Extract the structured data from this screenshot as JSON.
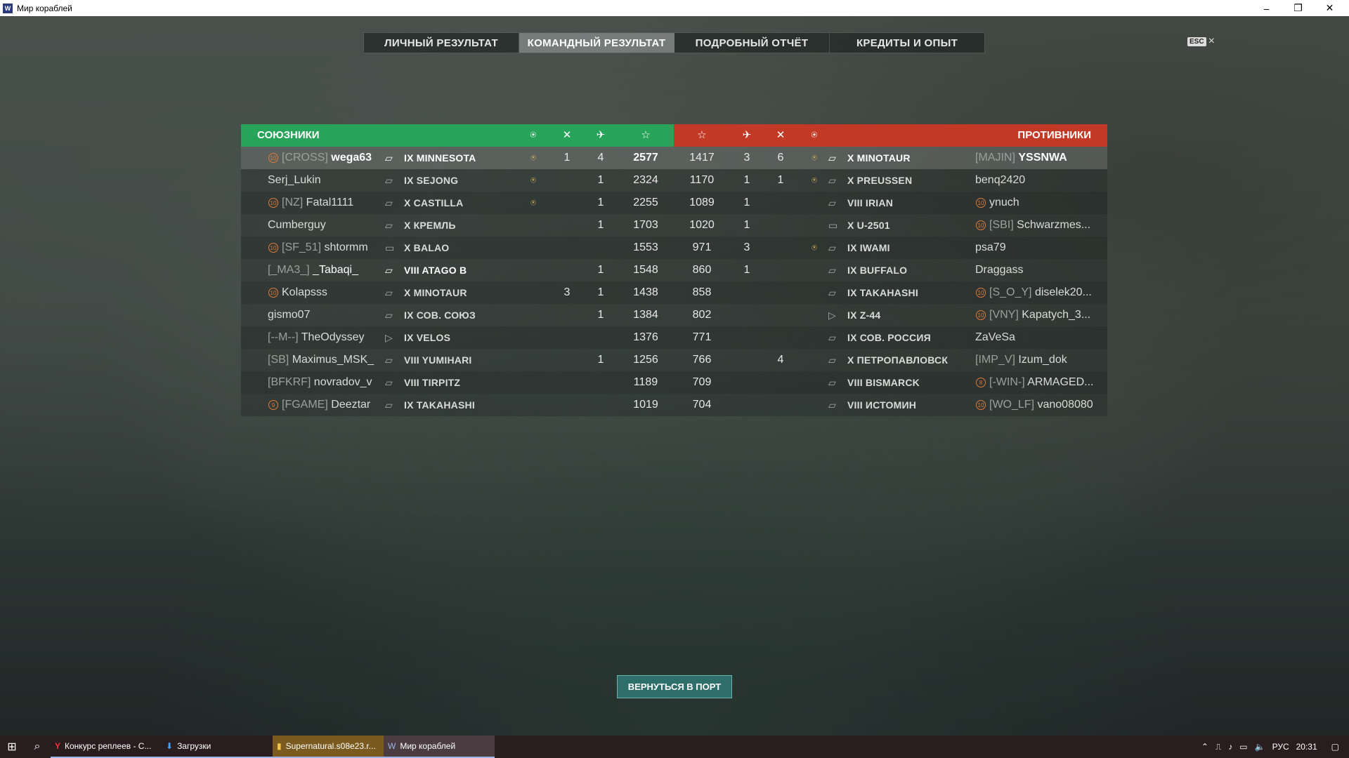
{
  "window": {
    "title": "Мир кораблей",
    "icon": "warships-app-icon"
  },
  "tabs": [
    {
      "label": "ЛИЧНЫЙ РЕЗУЛЬТАТ",
      "active": false
    },
    {
      "label": "КОМАНДНЫЙ РЕЗУЛЬТАТ",
      "active": true
    },
    {
      "label": "ПОДРОБНЫЙ ОТЧЁТ",
      "active": false
    },
    {
      "label": "КРЕДИТЫ И ОПЫТ",
      "active": false
    }
  ],
  "esc": {
    "key": "ESC",
    "close": "×"
  },
  "table": {
    "allies_label": "СОЮЗНИКИ",
    "enemies_label": "ПРОТИВНИКИ",
    "allies_color": "#27a35a",
    "enemies_color": "#c23a26",
    "allies": [
      {
        "rank": "10",
        "clan": "[CROSS]",
        "name": "wega63",
        "ship": "IX MINNESOTA",
        "medal": "yes",
        "kills": "1",
        "planes": "4",
        "xp": "2577",
        "highlight": true,
        "ship_icon": "battleship-icon"
      },
      {
        "rank": "",
        "clan": "",
        "name": "Serj_Lukin",
        "ship": "IX SEJONG",
        "medal": "yes",
        "kills": "",
        "planes": "1",
        "xp": "2324",
        "ship_icon": "battleship-icon"
      },
      {
        "rank": "10",
        "clan": "[NZ]",
        "name": "Fatal1111",
        "ship": "X CASTILLA",
        "medal": "yes",
        "kills": "",
        "planes": "1",
        "xp": "2255",
        "ship_icon": "battleship-icon"
      },
      {
        "rank": "",
        "clan": "",
        "name": "Cumberguy",
        "ship": "X КРЕМЛЬ",
        "medal": "",
        "kills": "",
        "planes": "1",
        "xp": "1703",
        "ship_icon": "battleship-icon"
      },
      {
        "rank": "10",
        "clan": "[SF_51]",
        "name": "shtormm",
        "ship": "X BALAO",
        "medal": "",
        "kills": "",
        "planes": "",
        "xp": "1553",
        "ship_icon": "submarine-icon"
      },
      {
        "rank": "",
        "clan": "[_MA3_]",
        "name": "_Tabaqi_",
        "ship": "VIII ATAGO B",
        "medal": "",
        "kills": "",
        "planes": "1",
        "xp": "1548",
        "highlight_name": true,
        "ship_icon": "cruiser-icon"
      },
      {
        "rank": "10",
        "clan": "",
        "name": "Kolapsss",
        "ship": "X MINOTAUR",
        "medal": "",
        "kills": "3",
        "planes": "1",
        "xp": "1438",
        "ship_icon": "cruiser-icon"
      },
      {
        "rank": "",
        "clan": "",
        "name": "gismo07",
        "ship": "IX СОВ. СОЮЗ",
        "medal": "",
        "kills": "",
        "planes": "1",
        "xp": "1384",
        "ship_icon": "battleship-icon"
      },
      {
        "rank": "",
        "clan": "[--M--]",
        "name": "TheOdyssey",
        "ship": "IX VELOS",
        "medal": "",
        "kills": "",
        "planes": "",
        "xp": "1376",
        "ship_icon": "destroyer-icon"
      },
      {
        "rank": "",
        "clan": "[SB]",
        "name": "Maximus_MSK_",
        "ship": "VIII YUMIHARI",
        "medal": "",
        "kills": "",
        "planes": "1",
        "xp": "1256",
        "ship_icon": "battleship-icon"
      },
      {
        "rank": "",
        "clan": "[BFKRF]",
        "name": "novradov_v",
        "ship": "VIII TIRPITZ",
        "medal": "",
        "kills": "",
        "planes": "",
        "xp": "1189",
        "ship_icon": "battleship-icon"
      },
      {
        "rank": "9",
        "clan": "[FGAME]",
        "name": "Deeztar",
        "ship": "IX TAKAHASHI",
        "medal": "",
        "kills": "",
        "planes": "",
        "xp": "1019",
        "ship_icon": "battleship-icon"
      }
    ],
    "enemies": [
      {
        "xp": "1417",
        "planes": "3",
        "kills": "6",
        "medal": "yes",
        "ship": "X MINOTAUR",
        "rank": "",
        "clan": "[MAJIN]",
        "name": "YSSNWA",
        "ship_icon": "cruiser-icon"
      },
      {
        "xp": "1170",
        "planes": "1",
        "kills": "1",
        "medal": "yes",
        "ship": "X PREUSSEN",
        "rank": "",
        "clan": "",
        "name": "benq2420",
        "ship_icon": "battleship-icon"
      },
      {
        "xp": "1089",
        "planes": "1",
        "kills": "",
        "medal": "",
        "ship": "VIII IRIAN",
        "rank": "10",
        "clan": "",
        "name": "ynuch",
        "ship_icon": "battleship-icon"
      },
      {
        "xp": "1020",
        "planes": "1",
        "kills": "",
        "medal": "",
        "ship": "X U-2501",
        "rank": "10",
        "clan": "[SBI]",
        "name": "Schwarzmes...",
        "ship_icon": "submarine-icon"
      },
      {
        "xp": "971",
        "planes": "3",
        "kills": "",
        "medal": "yes",
        "ship": "IX IWAMI",
        "rank": "",
        "clan": "",
        "name": "psa79",
        "ship_icon": "battleship-icon"
      },
      {
        "xp": "860",
        "planes": "1",
        "kills": "",
        "medal": "",
        "ship": "IX BUFFALO",
        "rank": "",
        "clan": "",
        "name": "Draggass",
        "ship_icon": "battleship-icon"
      },
      {
        "xp": "858",
        "planes": "",
        "kills": "",
        "medal": "",
        "ship": "IX TAKAHASHI",
        "rank": "10",
        "clan": "[S_O_Y]",
        "name": "diselek20...",
        "ship_icon": "battleship-icon"
      },
      {
        "xp": "802",
        "planes": "",
        "kills": "",
        "medal": "",
        "ship": "IX Z-44",
        "rank": "10",
        "clan": "[VNY]",
        "name": "Kapatych_3...",
        "ship_icon": "destroyer-icon"
      },
      {
        "xp": "771",
        "planes": "",
        "kills": "",
        "medal": "",
        "ship": "IX СОВ. РОССИЯ",
        "rank": "",
        "clan": "",
        "name": "ZaVeSa",
        "ship_icon": "battleship-icon"
      },
      {
        "xp": "766",
        "planes": "",
        "kills": "4",
        "medal": "",
        "ship": "X ПЕТРОПАВЛОВСК",
        "rank": "",
        "clan": "[IMP_V]",
        "name": "Izum_dok",
        "ship_icon": "battleship-icon"
      },
      {
        "xp": "709",
        "planes": "",
        "kills": "",
        "medal": "",
        "ship": "VIII BISMARCK",
        "rank": "8",
        "clan": "[-WIN-]",
        "name": "ARMAGED...",
        "ship_icon": "battleship-icon"
      },
      {
        "xp": "704",
        "planes": "",
        "kills": "",
        "medal": "",
        "ship": "VIII ИСТОМИН",
        "rank": "10",
        "clan": "[WO_LF]",
        "name": "vano08080",
        "ship_icon": "battleship-icon"
      }
    ]
  },
  "return_button": "ВЕРНУТЬСЯ В ПОРТ",
  "taskbar": {
    "items": [
      {
        "label": "Конкурс реплеев - С...",
        "icon": "yandex-browser-icon"
      },
      {
        "label": "Загрузки",
        "icon": "download-icon"
      },
      {
        "label": "Supernatural.s08e23.r...",
        "icon": "video-icon"
      },
      {
        "label": "Мир кораблей",
        "icon": "warships-app-icon"
      }
    ],
    "lang": "РУС",
    "time": "20:31"
  }
}
